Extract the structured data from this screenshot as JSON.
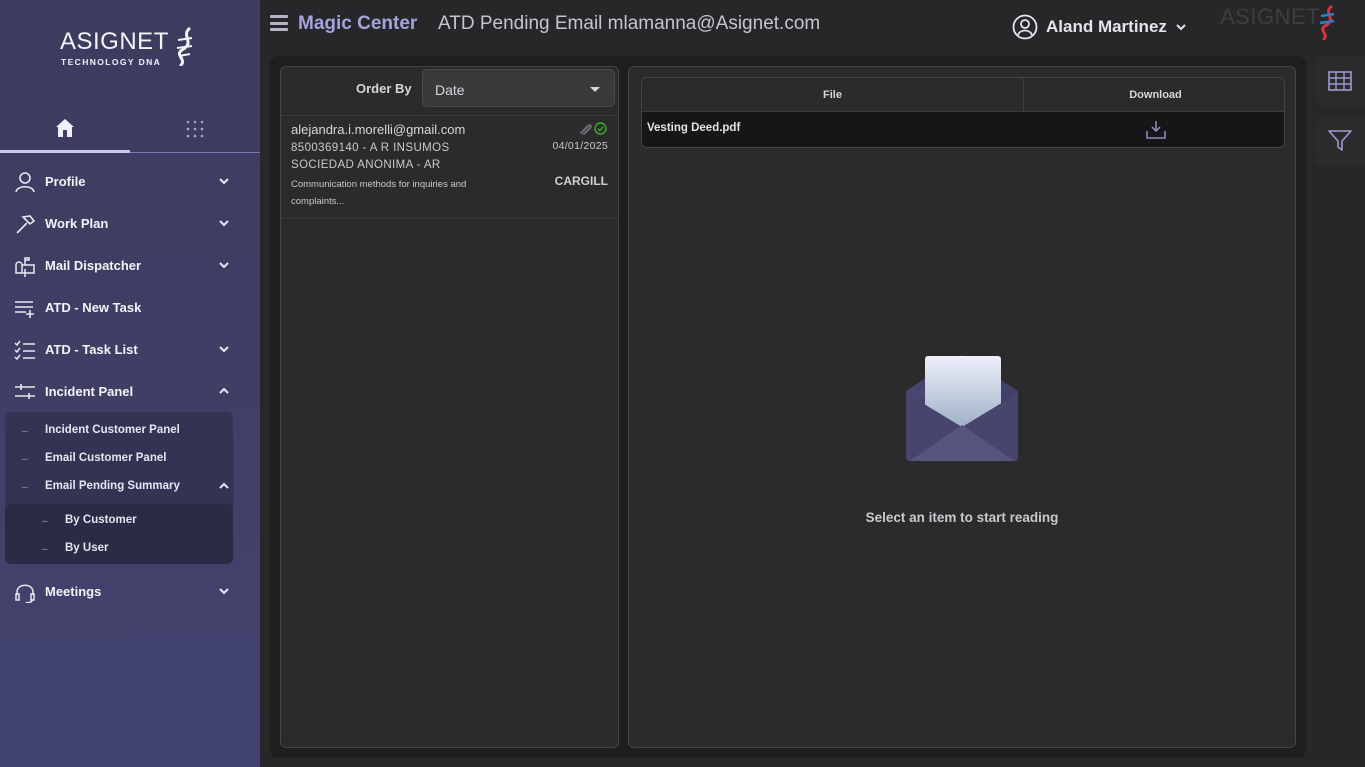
{
  "brand": {
    "name": "ASIGNET",
    "tagline": "TECHNOLOGY DNA"
  },
  "sidebar": {
    "tabs": [
      {
        "icon": "home-icon"
      },
      {
        "icon": "apps-grid-icon"
      }
    ],
    "items": [
      {
        "label": "Profile",
        "icon": "user-icon",
        "expanded": false
      },
      {
        "label": "Work Plan",
        "icon": "hammer-icon",
        "expanded": false
      },
      {
        "label": "Mail Dispatcher",
        "icon": "mailbox-icon",
        "expanded": false
      },
      {
        "label": "ATD - New Task",
        "icon": "list-add-icon"
      },
      {
        "label": "ATD - Task List",
        "icon": "checklist-icon",
        "expanded": false
      },
      {
        "label": "Incident Panel",
        "icon": "sliders-icon",
        "expanded": true
      },
      {
        "label": "Meetings",
        "icon": "headset-icon",
        "expanded": false
      }
    ],
    "incident_children": [
      {
        "label": "Incident Customer Panel"
      },
      {
        "label": "Email Customer Panel"
      },
      {
        "label": "Email Pending Summary"
      }
    ],
    "pending_children": [
      {
        "label": "By Customer"
      },
      {
        "label": "By User"
      }
    ]
  },
  "header": {
    "title": "Magic Center",
    "subtitle": "ATD Pending Email mlamanna@Asignet.com",
    "user_name": "Aland Martinez",
    "watermark": "ASIGNET"
  },
  "list": {
    "order_by_label": "Order By",
    "order_by_value": "Date",
    "items": [
      {
        "from": "alejandra.i.morelli@gmail.com",
        "subject": "8500369140 - A R INSUMOS SOCIEDAD ANONIMA - AR",
        "preview": "Communication methods for inquiries and complaints...",
        "date": "04/01/2025",
        "customer": "CARGILL"
      }
    ]
  },
  "reader": {
    "files_header": {
      "file": "File",
      "download": "Download"
    },
    "files": [
      {
        "name": "Vesting Deed.pdf"
      }
    ],
    "empty_text": "Select an item to start reading"
  },
  "rail": {
    "buttons": [
      {
        "icon": "table-icon"
      },
      {
        "icon": "filter-icon"
      }
    ]
  },
  "colors": {
    "accent": "#a4a4dd",
    "sidebar": "#3f3f66",
    "success": "#3fae2a"
  }
}
